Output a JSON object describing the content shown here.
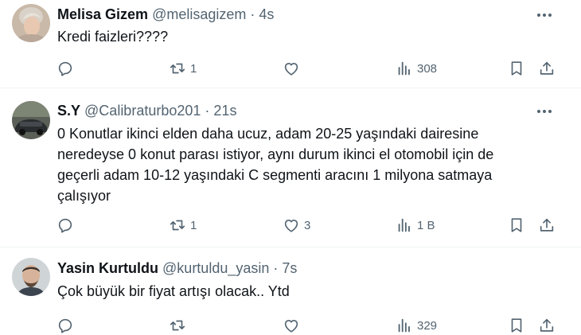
{
  "tweets": [
    {
      "name": "Melisa Gizem",
      "handle": "@melisagizem",
      "separator": "·",
      "time": "4s",
      "text": "Kredi faizleri????",
      "replies": "",
      "retweets": "1",
      "likes": "",
      "views": "308"
    },
    {
      "name": "S.Y",
      "handle": "@Calibraturbo201",
      "separator": "·",
      "time": "21s",
      "text": "0 Konutlar ikinci elden daha ucuz, adam 20-25 yaşındaki dairesine neredeyse 0 konut parası istiyor, aynı durum ikinci el otomobil için de geçerli adam 10-12 yaşındaki C segmenti aracını 1 milyona satmaya çalışıyor",
      "replies": "",
      "retweets": "1",
      "likes": "3",
      "views": "1 B"
    },
    {
      "name": "Yasin Kurtuldu",
      "handle": "@kurtuldu_yasin",
      "separator": "·",
      "time": "7s",
      "text": "Çok büyük bir fiyat artışı olacak.. Ytd",
      "replies": "",
      "retweets": "",
      "likes": "",
      "views": "329"
    }
  ],
  "icons": {
    "reply": "reply-icon",
    "retweet": "retweet-icon",
    "like": "like-icon",
    "views": "views-icon",
    "bookmark": "bookmark-icon",
    "share": "share-icon",
    "more": "more-icon"
  },
  "colors": {
    "text": "#0f1419",
    "secondary": "#536471",
    "divider": "#eff3f4"
  }
}
